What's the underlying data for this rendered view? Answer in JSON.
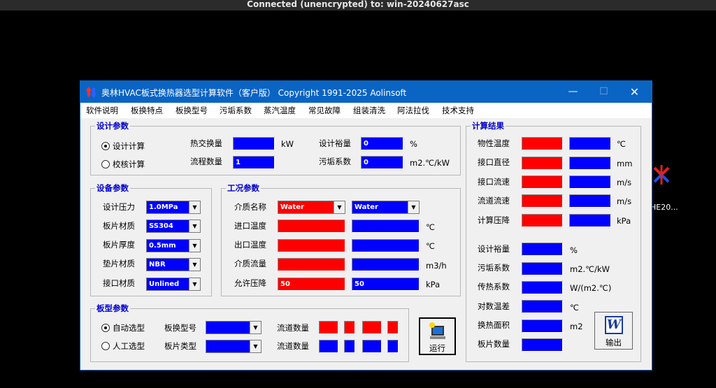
{
  "topbar": {
    "text": "Connected (unencrypted) to: win-20240627asc"
  },
  "desktop": {
    "icon_label": "HE20..."
  },
  "window": {
    "title": "奥林HVAC板式换热器选型计算软件（客户版）   Copyright 1991-2025   Aolinsoft"
  },
  "menu": [
    "软件说明",
    "板换特点",
    "板换型号",
    "污垢系数",
    "蒸汽温度",
    "常见故障",
    "组装清洗",
    "阿法拉伐",
    "技术支持"
  ],
  "design": {
    "title": "设计参数",
    "radio_design": "设计计算",
    "radio_check": "校核计算",
    "selected": "设计计算",
    "heat_label": "热交换量",
    "heat_value": "",
    "heat_unit": "kW",
    "passes_label": "流程数量",
    "passes_value": "1",
    "margin_label": "设计裕量",
    "margin_value": "0",
    "margin_unit": "%",
    "fouling_label": "污垢系数",
    "fouling_value": "0",
    "fouling_unit": "m2.℃/kW"
  },
  "equipment": {
    "title": "设备参数",
    "rows": [
      {
        "label": "设计压力",
        "value": "1.0MPa"
      },
      {
        "label": "板片材质",
        "value": "SS304"
      },
      {
        "label": "板片厚度",
        "value": "0.5mm"
      },
      {
        "label": "垫片材质",
        "value": "NBR"
      },
      {
        "label": "接口材质",
        "value": "Unlined"
      }
    ]
  },
  "working": {
    "title": "工况参数",
    "medium_label": "介质名称",
    "medium_hot": "Water",
    "medium_cold": "Water",
    "inlet_label": "进口温度",
    "inlet_unit": "℃",
    "outlet_label": "出口温度",
    "outlet_unit": "℃",
    "flow_label": "介质流量",
    "flow_unit": "m3/h",
    "pressure_label": "允许压降",
    "pressure_hot": "50",
    "pressure_cold": "50",
    "pressure_unit": "kPa"
  },
  "plate": {
    "title": "板型参数",
    "radio_auto": "自动选型",
    "radio_manual": "人工选型",
    "selected": "自动选型",
    "model_label": "板换型号",
    "type_label": "板片类型",
    "channels_label_1": "流道数量",
    "channels_label_2": "流道数量"
  },
  "run_button": {
    "label": "运行"
  },
  "export_button": {
    "label": "输出",
    "icon_letter": "W"
  },
  "results": {
    "title": "计算结果",
    "rows": [
      {
        "label": "物性温度",
        "unit": "℃"
      },
      {
        "label": "接口直径",
        "unit": "mm"
      },
      {
        "label": "接口流速",
        "unit": "m/s"
      },
      {
        "label": "流道流速",
        "unit": "m/s"
      },
      {
        "label": "计算压降",
        "unit": "kPa"
      }
    ],
    "single": [
      {
        "label": "设计裕量",
        "unit": "%"
      },
      {
        "label": "污垢系数",
        "unit": "m2.℃/kW"
      },
      {
        "label": "传热系数",
        "unit": "W/(m2.℃)"
      },
      {
        "label": "对数温差",
        "unit": "℃"
      },
      {
        "label": "换热面积",
        "unit": "m2"
      },
      {
        "label": "板片数量",
        "unit": ""
      }
    ]
  }
}
